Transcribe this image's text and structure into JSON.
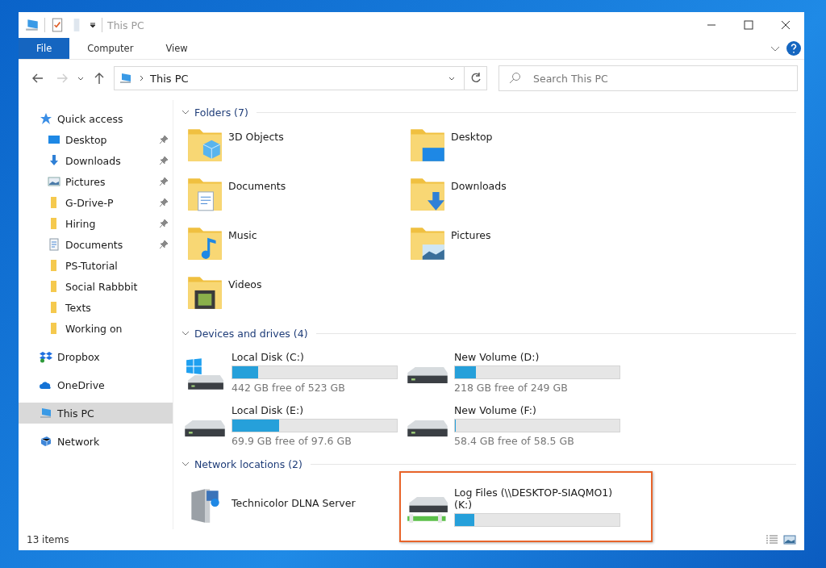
{
  "window": {
    "title": "This PC"
  },
  "ribbon_tabs": [
    {
      "label": "File",
      "selected": true
    },
    {
      "label": "Computer",
      "selected": false
    },
    {
      "label": "View",
      "selected": false
    }
  ],
  "address": {
    "path": "This PC"
  },
  "search": {
    "placeholder": "Search This PC"
  },
  "sidebar": {
    "items": [
      {
        "label": "Quick access",
        "kind": "star",
        "selected": false,
        "children": [
          {
            "label": "Desktop",
            "kind": "desktop",
            "pinned": true,
            "selected": false
          },
          {
            "label": "Downloads",
            "kind": "download",
            "pinned": true,
            "selected": false
          },
          {
            "label": "Pictures",
            "kind": "pictures",
            "pinned": true,
            "selected": false
          },
          {
            "label": "G-Drive-P",
            "kind": "folder",
            "pinned": true,
            "selected": false
          },
          {
            "label": "Hiring",
            "kind": "folder",
            "pinned": true,
            "selected": false
          },
          {
            "label": "Documents",
            "kind": "document",
            "pinned": true,
            "selected": false
          },
          {
            "label": "PS-Tutorial",
            "kind": "folder",
            "pinned": false,
            "selected": false
          },
          {
            "label": "Social Rabbbit",
            "kind": "folder",
            "pinned": false,
            "selected": false
          },
          {
            "label": "Texts",
            "kind": "folder",
            "pinned": false,
            "selected": false
          },
          {
            "label": "Working on",
            "kind": "folder",
            "pinned": false,
            "selected": false
          }
        ]
      },
      {
        "label": "Dropbox",
        "kind": "dropbox",
        "selected": false
      },
      {
        "label": "OneDrive",
        "kind": "cloud",
        "selected": false
      },
      {
        "label": "This PC",
        "kind": "computer",
        "selected": true
      },
      {
        "label": "Network",
        "kind": "network",
        "selected": false
      }
    ]
  },
  "sections": [
    {
      "title": "Folders (7)",
      "kind": "folders",
      "items": [
        {
          "name": "3D Objects",
          "kind": "cube"
        },
        {
          "name": "Desktop",
          "kind": "desktop"
        },
        {
          "name": "Documents",
          "kind": "document"
        },
        {
          "name": "Downloads",
          "kind": "download"
        },
        {
          "name": "Music",
          "kind": "music"
        },
        {
          "name": "Pictures",
          "kind": "pictures"
        },
        {
          "name": "Videos",
          "kind": "video"
        }
      ]
    },
    {
      "title": "Devices and drives (4)",
      "kind": "drives",
      "items": [
        {
          "name": "Local Disk (C:)",
          "kind": "system",
          "level": 0.155,
          "free": "442 GB free of 523 GB",
          "highlighted": false
        },
        {
          "name": "New Volume (D:)",
          "kind": "disk",
          "level": 0.125,
          "free": "218 GB free of 249 GB",
          "highlighted": false
        },
        {
          "name": "Local Disk (E:)",
          "kind": "disk",
          "level": 0.284,
          "free": "69.9 GB free of 97.6 GB",
          "highlighted": false
        },
        {
          "name": "New Volume (F:)",
          "kind": "disk",
          "level": 0.002,
          "free": "58.4 GB free of 58.5 GB",
          "highlighted": false
        }
      ]
    },
    {
      "title": "Network locations (2)",
      "kind": "drives",
      "items": [
        {
          "name": "Technicolor DLNA Server",
          "kind": "media-server",
          "highlighted": false
        },
        {
          "name": "Log Files (\\\\DESKTOP-SIAQMO1) (K:)",
          "kind": "network-drive",
          "level": 0.12,
          "highlighted": true
        }
      ]
    }
  ],
  "status_bar": {
    "count": "13 items"
  }
}
